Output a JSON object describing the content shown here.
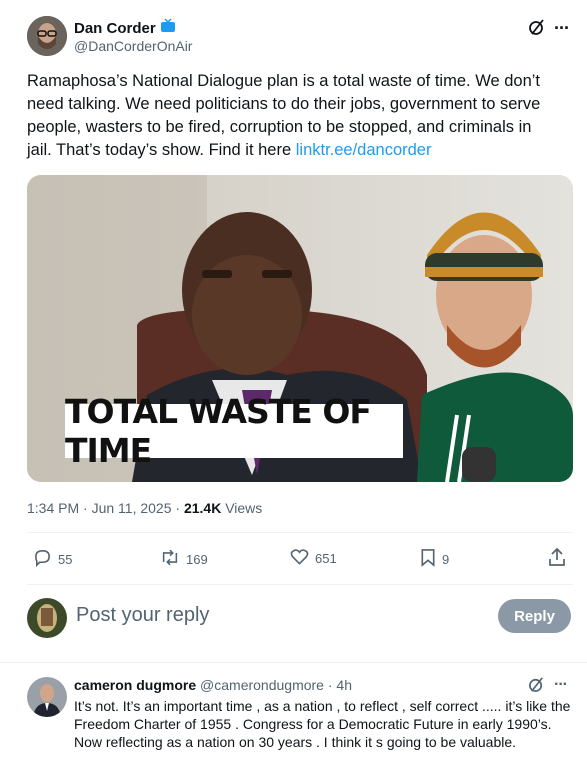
{
  "post": {
    "author_name": "Dan Corder",
    "author_handle": "@DanCorderOnAir",
    "text": "Ramaphosa’s National Dialogue plan is a total waste of time. We don’t need talking. We need politicians to do their jobs, government to serve people, wasters to be fired, corruption to be stopped, and criminals in jail. That’s today’s show. Find it here ",
    "link_text": "linktr.ee/dancorder",
    "media_banner": "TOTAL WASTE OF TIME",
    "time": "1:34 PM · Jun 11, 2025 · ",
    "views_count": "21.4K",
    "views_label": "Views",
    "replies": "55",
    "reposts": "169",
    "likes": "651",
    "bookmarks": "9"
  },
  "reply_box": {
    "placeholder": "Post your reply",
    "button": "Reply"
  },
  "comment": {
    "author_name": "cameron dugmore",
    "author_handle": "@camerondugmore",
    "age": "· 4h",
    "text": "It’s not. It’s an important time , as a nation , to reflect , self correct ..... it’s like the Freedom Charter of 1955 . Congress for a Democratic Future in early 1990’s. Now reflecting as a nation on 30 years . I think it s going to be valuable."
  },
  "icons": {
    "verified": "tv-badge-icon",
    "grok": "grok-icon",
    "more": "more-icon",
    "reply": "reply-icon",
    "repost": "repost-icon",
    "like": "like-icon",
    "bookmark": "bookmark-icon",
    "share": "share-icon"
  },
  "colors": {
    "link": "#1d9bf0",
    "muted": "#536471",
    "reply_button": "#8b98a5",
    "badge": "#1d9bf0"
  }
}
